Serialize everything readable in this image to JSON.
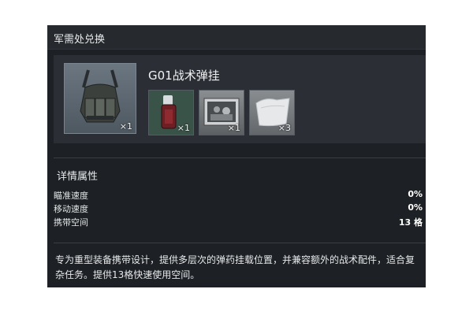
{
  "header": {
    "title": "军需处兑换"
  },
  "main_item": {
    "name": "G01战术弹挂",
    "qty": "×1",
    "icon": "tactical-vest-icon"
  },
  "materials": [
    {
      "icon": "red-handle-tool-icon",
      "qty": "×1"
    },
    {
      "icon": "photo-print-icon",
      "qty": "×1"
    },
    {
      "icon": "cloth-sheet-icon",
      "qty": "×3"
    }
  ],
  "details": {
    "title": "详情属性",
    "attributes": [
      {
        "label": "瞄准速度",
        "value": "0%"
      },
      {
        "label": "移动速度",
        "value": "0%"
      },
      {
        "label": "携带空间",
        "value": "13 格"
      }
    ]
  },
  "description": "专为重型装备携带设计，提供多层次的弹药挂载位置，并兼容额外的战术配件，适合复杂任务。提供13格快速使用空间。",
  "colors": {
    "panel_bg": "#1d2024",
    "card_bg": "#2b2f35",
    "material_green": "#3a5348"
  }
}
